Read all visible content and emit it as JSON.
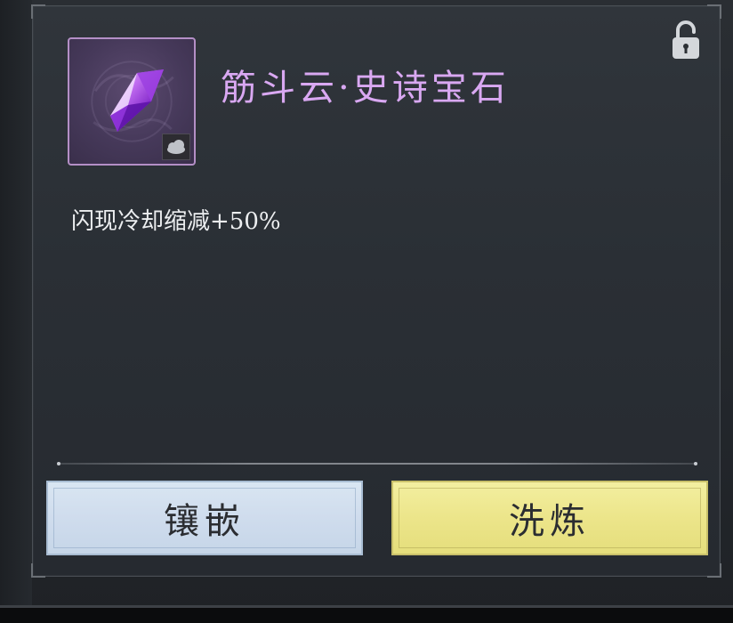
{
  "item": {
    "title": "筋斗云·史诗宝石",
    "description": "闪现冷却缩减+50%",
    "icon": "purple-gem-icon",
    "badge_icon": "cloud-icon",
    "rarity_color": "#b48fc6",
    "title_color": "#d9a8f2"
  },
  "lock": {
    "icon": "unlocked-padlock-icon",
    "state": "unlocked"
  },
  "actions": {
    "inlay_label": "镶嵌",
    "refine_label": "洗炼",
    "inlay_color": "#d2e0ee",
    "refine_color": "#ece58a"
  }
}
